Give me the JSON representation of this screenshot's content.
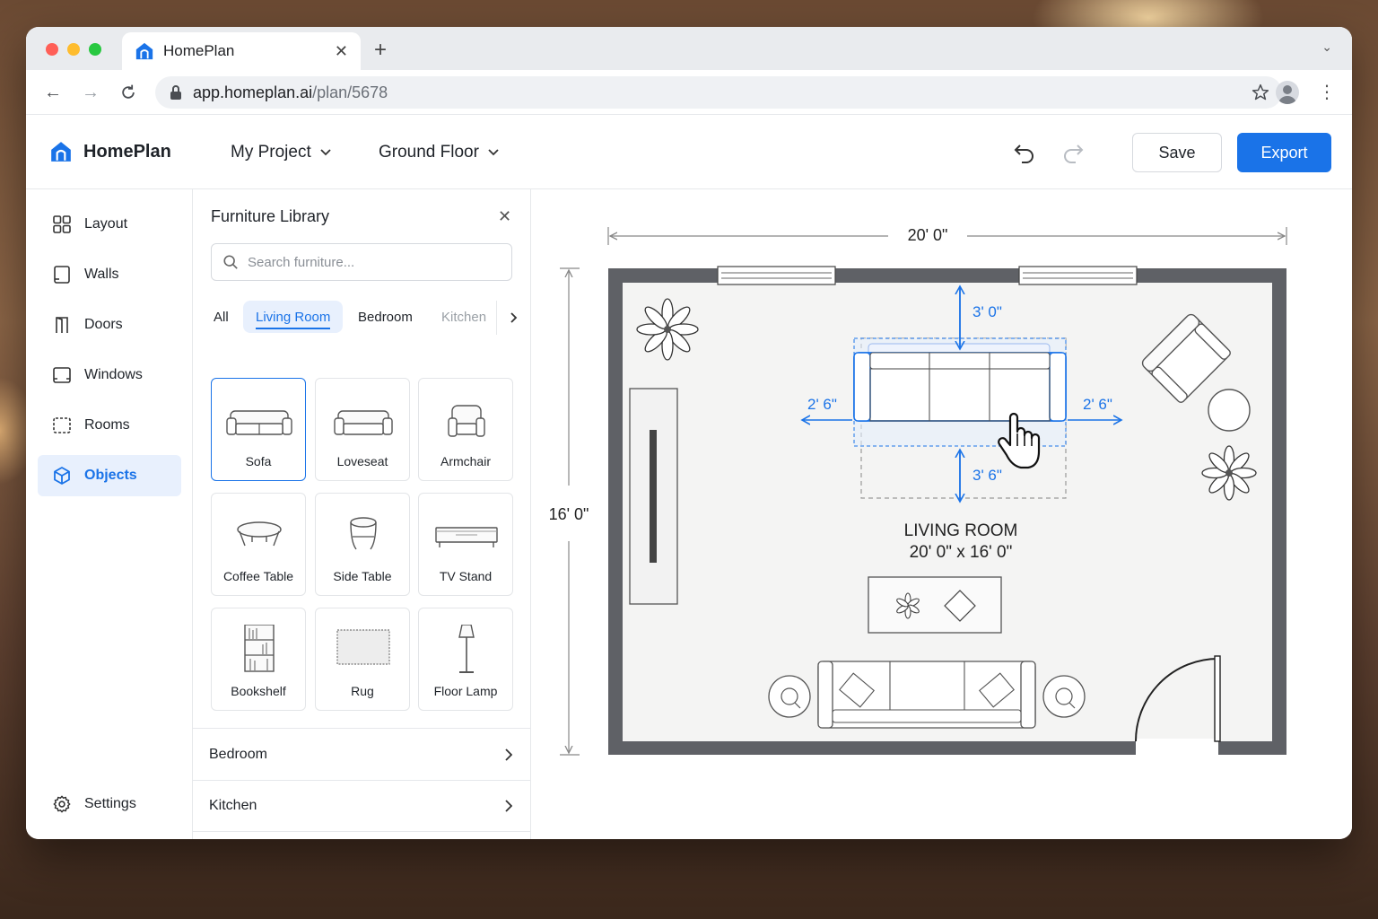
{
  "browser": {
    "tab_title": "HomePlan",
    "url_host": "app.homeplan.ai",
    "url_path": "/plan/5678"
  },
  "header": {
    "brand": "HomePlan",
    "project": "My Project",
    "floor": "Ground Floor",
    "save_label": "Save",
    "export_label": "Export"
  },
  "sidebar": {
    "items": [
      {
        "label": "Layout",
        "icon": "layout-icon"
      },
      {
        "label": "Walls",
        "icon": "walls-icon"
      },
      {
        "label": "Doors",
        "icon": "door-icon"
      },
      {
        "label": "Windows",
        "icon": "window-icon"
      },
      {
        "label": "Rooms",
        "icon": "rooms-icon"
      },
      {
        "label": "Objects",
        "icon": "cube-icon",
        "active": true
      }
    ],
    "settings_label": "Settings"
  },
  "library": {
    "title": "Furniture Library",
    "search_placeholder": "Search furniture...",
    "categories": [
      "All",
      "Living Room",
      "Bedroom",
      "Kitchen"
    ],
    "active_category": "Living Room",
    "items": [
      {
        "label": "Sofa",
        "selected": true
      },
      {
        "label": "Loveseat"
      },
      {
        "label": "Armchair"
      },
      {
        "label": "Coffee Table"
      },
      {
        "label": "Side Table"
      },
      {
        "label": "TV Stand"
      },
      {
        "label": "Bookshelf"
      },
      {
        "label": "Rug"
      },
      {
        "label": "Floor Lamp"
      }
    ],
    "sections": [
      "Bedroom",
      "Kitchen"
    ]
  },
  "plan": {
    "room_name": "LIVING ROOM",
    "room_size": "20' 0\" x 16' 0\"",
    "width_dim": "20' 0\"",
    "height_dim": "16' 0\"",
    "clearance_top": "3' 0\"",
    "clearance_bottom": "3' 6\"",
    "clearance_left": "2' 6\"",
    "clearance_right": "2' 6\""
  },
  "colors": {
    "accent": "#1a73e8",
    "wall": "#5f6166",
    "floor": "#f4f4f3"
  }
}
